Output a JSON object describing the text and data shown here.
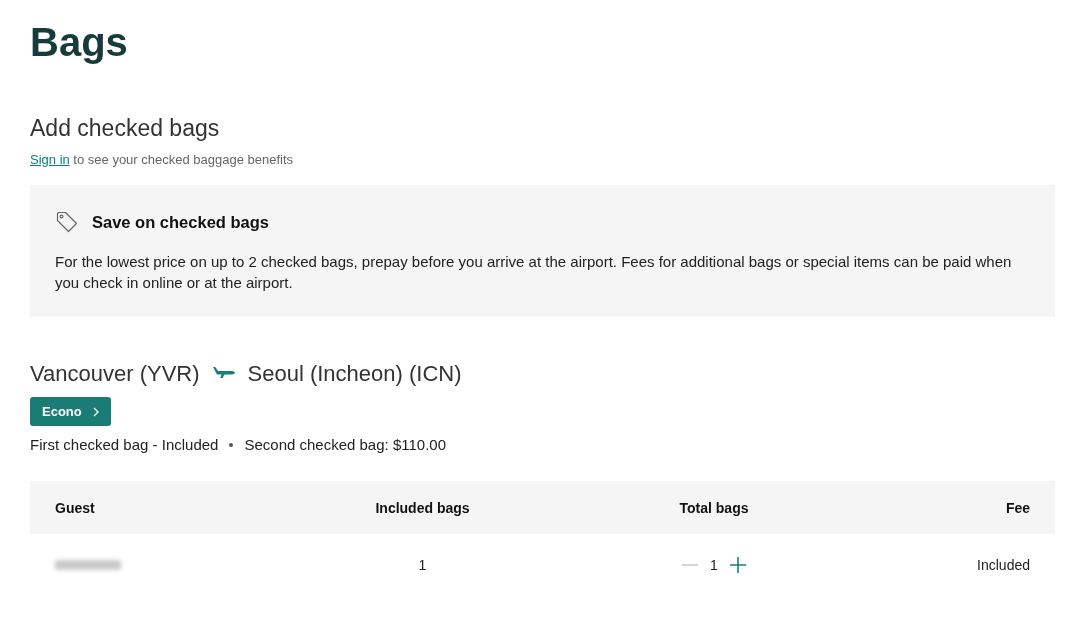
{
  "page_title": "Bags",
  "section": {
    "title": "Add checked bags",
    "sign_in_prompt": {
      "link": "Sign in",
      "text": "to see your checked baggage benefits"
    }
  },
  "notice": {
    "title": "Save on checked bags",
    "body": "For the lowest price on up to 2 checked bags, prepay before you arrive at the airport. Fees for additional bags or special items can be paid when you check in online or at the airport."
  },
  "flight": {
    "origin": "Vancouver (YVR)",
    "destination": "Seoul (Incheon) (ICN)",
    "fare_button": "Econo",
    "allowances": [
      "First checked bag - Included",
      "Second checked bag: $110.00"
    ]
  },
  "table": {
    "columns": [
      "Guest",
      "Included bags",
      "Total bags",
      "Fee"
    ],
    "rows": [
      {
        "guest_blurred": true,
        "included_bags": "1",
        "total_bags": {
          "value": "1",
          "decrement_disabled": true,
          "increment_disabled": false
        },
        "fee": "Included"
      }
    ]
  }
}
